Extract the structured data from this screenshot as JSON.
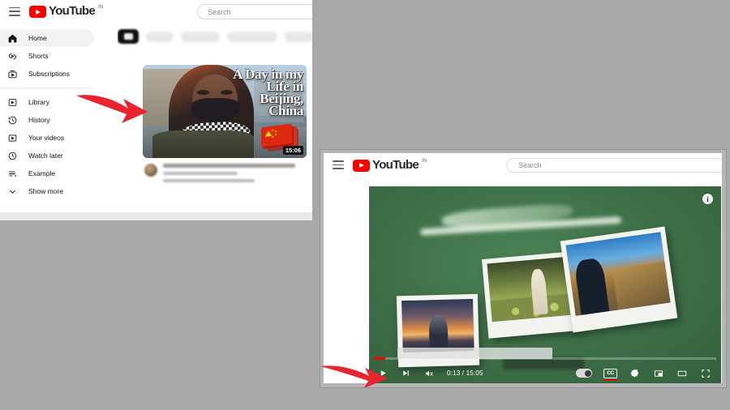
{
  "theme": {
    "page_background": "#a8a8a8",
    "brand_red": "#FF0000",
    "player_background": "#3f7248",
    "accent_arrow": "#e8252e"
  },
  "window_home": {
    "header": {
      "menu_icon": "hamburger-icon",
      "logo_text": "YouTube",
      "logo_country": "IN",
      "search_placeholder": "Search"
    },
    "chips": [
      {
        "label": "",
        "type": "all-icon-chip",
        "selected": true
      },
      {
        "label": "",
        "type": "blurred-chip"
      },
      {
        "label": "",
        "type": "blurred-chip"
      },
      {
        "label": "",
        "type": "blurred-chip"
      },
      {
        "label": "",
        "type": "blurred-chip"
      }
    ],
    "sidebar": {
      "group_main": [
        {
          "label": "Home",
          "icon": "home-icon",
          "active": true
        },
        {
          "label": "Shorts",
          "icon": "shorts-icon",
          "active": false
        },
        {
          "label": "Subscriptions",
          "icon": "subscriptions-icon",
          "active": false
        }
      ],
      "group_you": [
        {
          "label": "Library",
          "icon": "library-icon"
        },
        {
          "label": "History",
          "icon": "history-icon"
        },
        {
          "label": "Your videos",
          "icon": "your-videos-icon"
        },
        {
          "label": "Watch later",
          "icon": "watch-later-icon"
        },
        {
          "label": "Example",
          "icon": "playlist-icon"
        },
        {
          "label": "Show more",
          "icon": "chevron-down-icon"
        }
      ]
    },
    "video_card": {
      "thumbnail_title_lines": [
        "A Day in my",
        "Life in",
        "Beijing,",
        "China"
      ],
      "duration": "15:06",
      "overlay_graphic": "china-flag",
      "title": "",
      "channel": "",
      "stats": ""
    }
  },
  "window_watch": {
    "header": {
      "menu_icon": "hamburger-icon",
      "logo_text": "YouTube",
      "logo_country": "IN",
      "search_placeholder": "Search"
    },
    "player": {
      "info_button_label": "i",
      "time_display": "0:13 / 15:05",
      "current_time": "0:13",
      "duration": "15:05",
      "progress_percent": 1.4,
      "cc_label": "CC",
      "cc_enabled": true,
      "muted": true,
      "autoplay_on": false,
      "controls": [
        {
          "name": "play-button",
          "icon": "play-icon"
        },
        {
          "name": "next-button",
          "icon": "next-icon"
        },
        {
          "name": "mute-button",
          "icon": "volume-muted-icon"
        },
        {
          "name": "autoplay-toggle",
          "icon": "autoplay-toggle-icon"
        },
        {
          "name": "captions-button",
          "icon": "cc-icon"
        },
        {
          "name": "settings-button",
          "icon": "gear-icon"
        },
        {
          "name": "miniplayer-button",
          "icon": "miniplayer-icon"
        },
        {
          "name": "theater-button",
          "icon": "theater-icon"
        },
        {
          "name": "fullscreen-button",
          "icon": "fullscreen-icon"
        }
      ],
      "scene": {
        "background": "green-chalkboard",
        "photos": [
          "sunset-observation-deck",
          "greenhouse-garden",
          "great-wall-victory-pose"
        ]
      }
    }
  },
  "annotations": [
    {
      "name": "arrow-to-video-thumbnail",
      "shape": "curved-red-arrow",
      "direction": "right"
    },
    {
      "name": "arrow-to-play-button",
      "shape": "curved-red-arrow",
      "direction": "right"
    }
  ]
}
